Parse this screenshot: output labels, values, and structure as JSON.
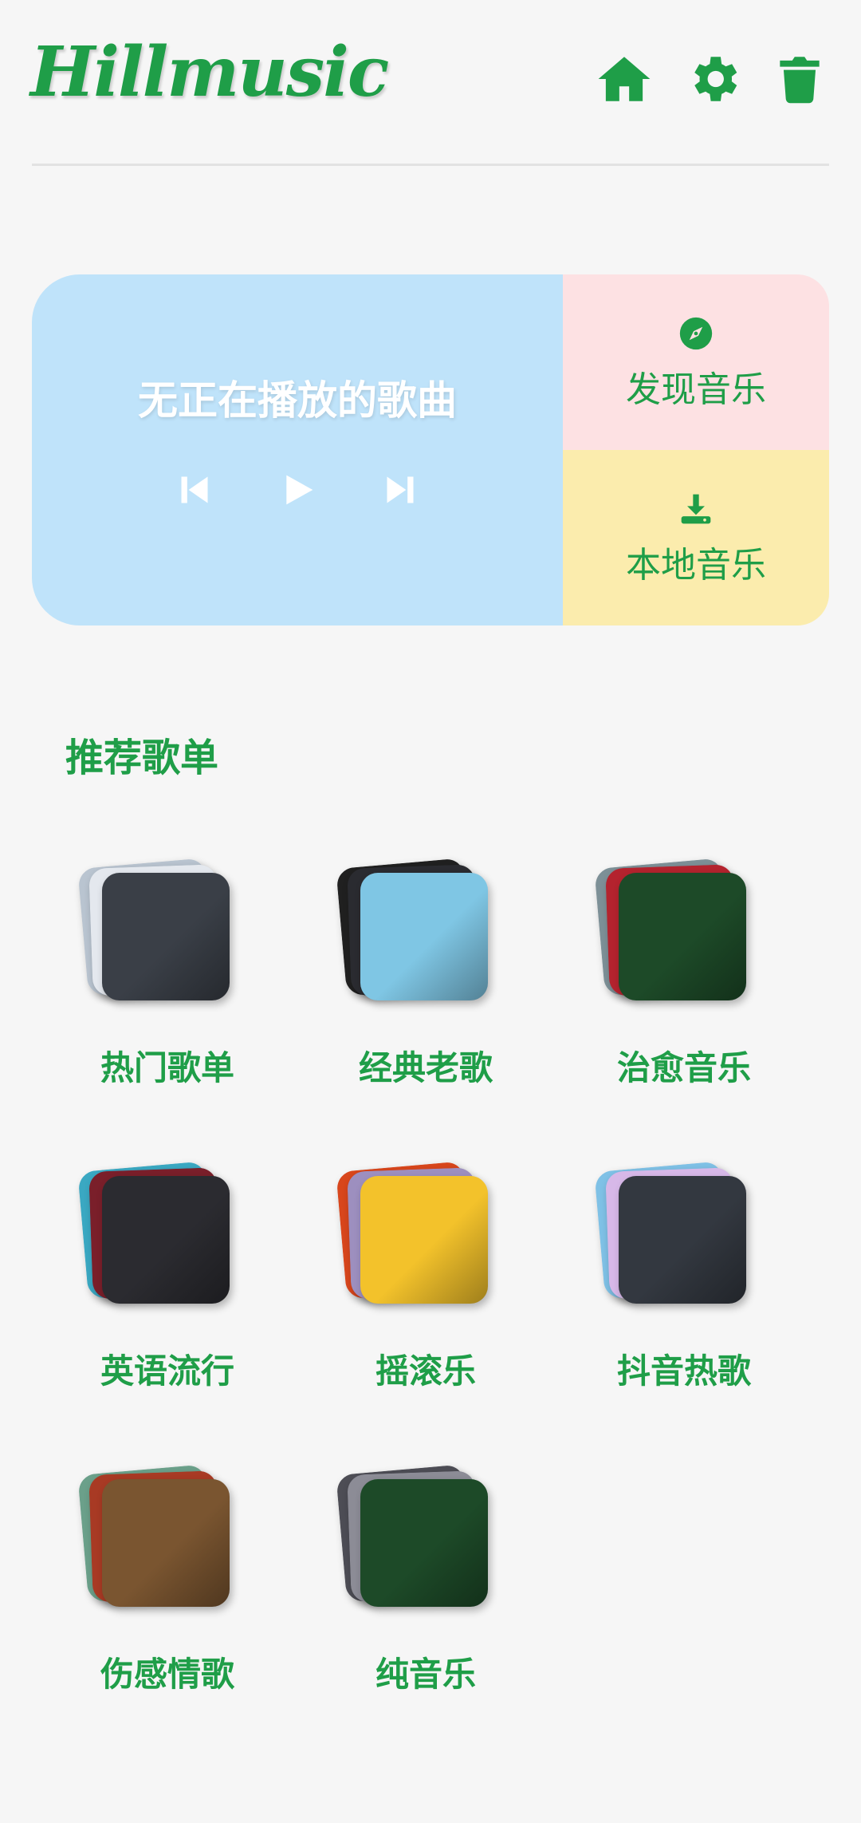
{
  "app": {
    "title": "Hillmusic"
  },
  "header": {
    "icons": [
      "home-icon",
      "settings-gear-icon",
      "trash-icon"
    ]
  },
  "player": {
    "now_playing": "无正在播放的歌曲",
    "controls": [
      "previous-icon",
      "play-icon",
      "next-icon"
    ]
  },
  "tiles": {
    "discover": {
      "label": "发现音乐",
      "icon": "compass-icon"
    },
    "local": {
      "label": "本地音乐",
      "icon": "download-icon"
    }
  },
  "recommend": {
    "title": "推荐歌单",
    "playlists": [
      {
        "label": "热门歌单",
        "colors": [
          "#b9c4d0",
          "#e4e8ee",
          "#3a3f47"
        ]
      },
      {
        "label": "经典老歌",
        "colors": [
          "#202020",
          "#2a2b30",
          "#7fc6e4"
        ]
      },
      {
        "label": "治愈音乐",
        "colors": [
          "#7d9097",
          "#b4232e",
          "#1d4a28"
        ]
      },
      {
        "label": "英语流行",
        "colors": [
          "#3aa8c2",
          "#7a1f2a",
          "#2b2b30"
        ]
      },
      {
        "label": "摇滚乐",
        "colors": [
          "#d8461c",
          "#9d8fbf",
          "#f3c22b"
        ]
      },
      {
        "label": "抖音热歌",
        "colors": [
          "#7fc1e6",
          "#d7b8e8",
          "#333840"
        ]
      },
      {
        "label": "伤感情歌",
        "colors": [
          "#6ba08a",
          "#a83a24",
          "#7a5530"
        ]
      },
      {
        "label": "纯音乐",
        "colors": [
          "#4d4d55",
          "#8c8c96",
          "#1d4a28"
        ]
      }
    ]
  },
  "colors": {
    "accent": "#1f9e48",
    "player_bg": "#bfe3fa",
    "discover_bg": "#fde1e3",
    "local_bg": "#fbecad",
    "page_bg": "#f6f6f6"
  }
}
